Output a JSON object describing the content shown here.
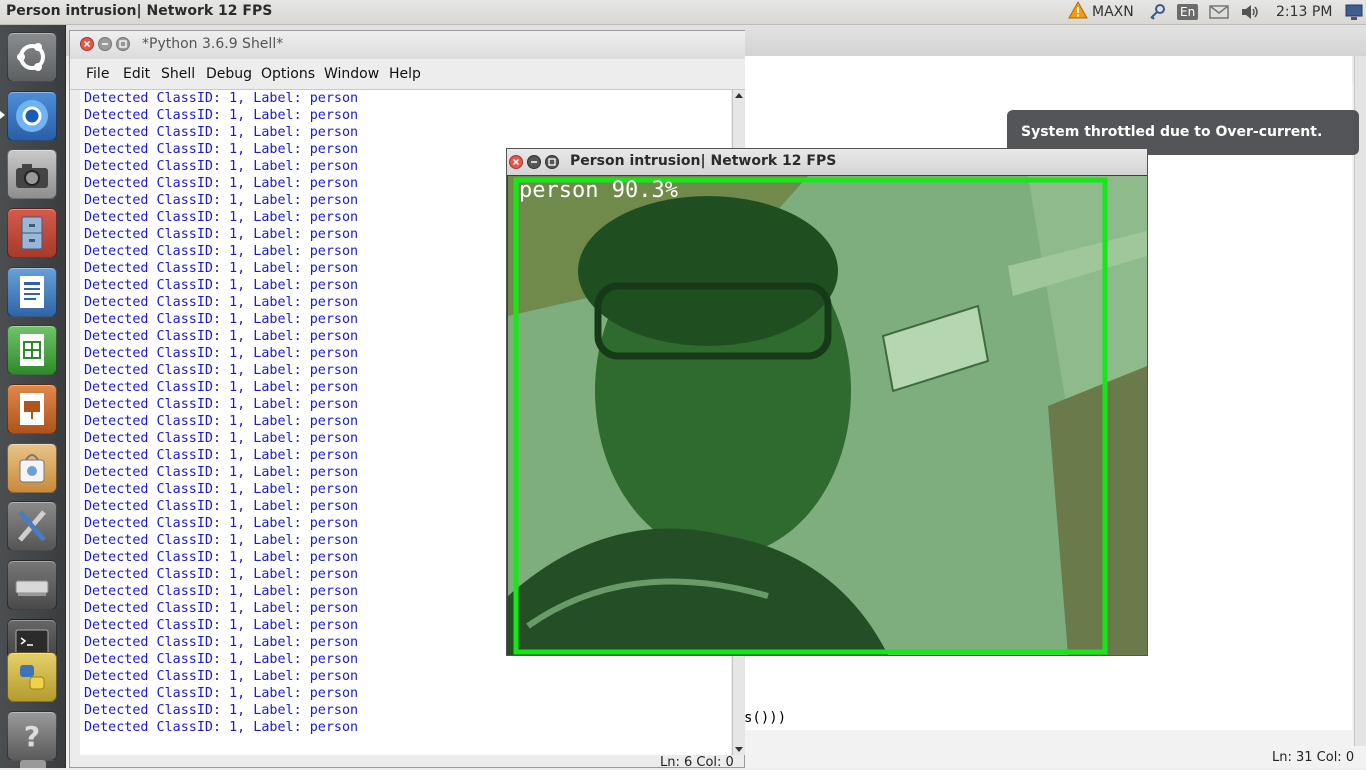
{
  "top_panel": {
    "title": "Person intrusion| Network 12 FPS",
    "power_mode": "MAXN",
    "keyboard_layout": "En",
    "time": "2:13 PM",
    "icons": [
      "warning-icon",
      "network-key-icon",
      "keyboard-icon",
      "mail-icon",
      "volume-icon",
      "display-icon"
    ]
  },
  "launcher": {
    "items": [
      "ubuntu-dash",
      "chromium",
      "screenshot",
      "file-manager",
      "writer",
      "calc",
      "impress",
      "software-center",
      "system-settings",
      "drive",
      "terminal",
      "python",
      "help",
      "trash"
    ]
  },
  "shell": {
    "title": "*Python 3.6.9 Shell*",
    "menu": [
      "File",
      "Edit",
      "Shell",
      "Debug",
      "Options",
      "Window",
      "Help"
    ],
    "output_lines": [
      "Detected ClassID: 1, Label: person",
      "Detected ClassID: 1, Label: person",
      "Detected ClassID: 1, Label: person",
      "Detected ClassID: 1, Label: person",
      "Detected ClassID: 1, Label: person",
      "Detected ClassID: 1, Label: person",
      "Detected ClassID: 1, Label: person",
      "Detected ClassID: 1, Label: person",
      "Detected ClassID: 1, Label: person",
      "Detected ClassID: 1, Label: person",
      "Detected ClassID: 1, Label: person",
      "Detected ClassID: 1, Label: person",
      "Detected ClassID: 1, Label: person",
      "Detected ClassID: 1, Label: person",
      "Detected ClassID: 1, Label: person",
      "Detected ClassID: 1, Label: person",
      "Detected ClassID: 1, Label: person",
      "Detected ClassID: 1, Label: person",
      "Detected ClassID: 1, Label: person",
      "Detected ClassID: 1, Label: person",
      "Detected ClassID: 1, Label: person",
      "Detected ClassID: 1, Label: person",
      "Detected ClassID: 1, Label: person",
      "Detected ClassID: 1, Label: person",
      "Detected ClassID: 1, Label: person",
      "Detected ClassID: 1, Label: person",
      "Detected ClassID: 1, Label: person",
      "Detected ClassID: 1, Label: person",
      "Detected ClassID: 1, Label: person",
      "Detected ClassID: 1, Label: person",
      "Detected ClassID: 1, Label: person",
      "Detected ClassID: 1, Label: person",
      "Detected ClassID: 1, Label: person",
      "Detected ClassID: 1, Label: person",
      "Detected ClassID: 1, Label: person",
      "Detected ClassID: 1, Label: person",
      "Detected ClassID: 1, Label: person",
      "Detected ClassID: 1, Label: person"
    ],
    "status": "Ln: 6   Col: 0"
  },
  "editor": {
    "code_fragment": "s()))",
    "status": "Ln: 31   Col: 0"
  },
  "notification": {
    "text": "System throttled due to Over-current."
  },
  "video": {
    "title": "Person intrusion| Network 12 FPS",
    "detection_label": "person 90.3%",
    "detection_color": "#19e619"
  }
}
